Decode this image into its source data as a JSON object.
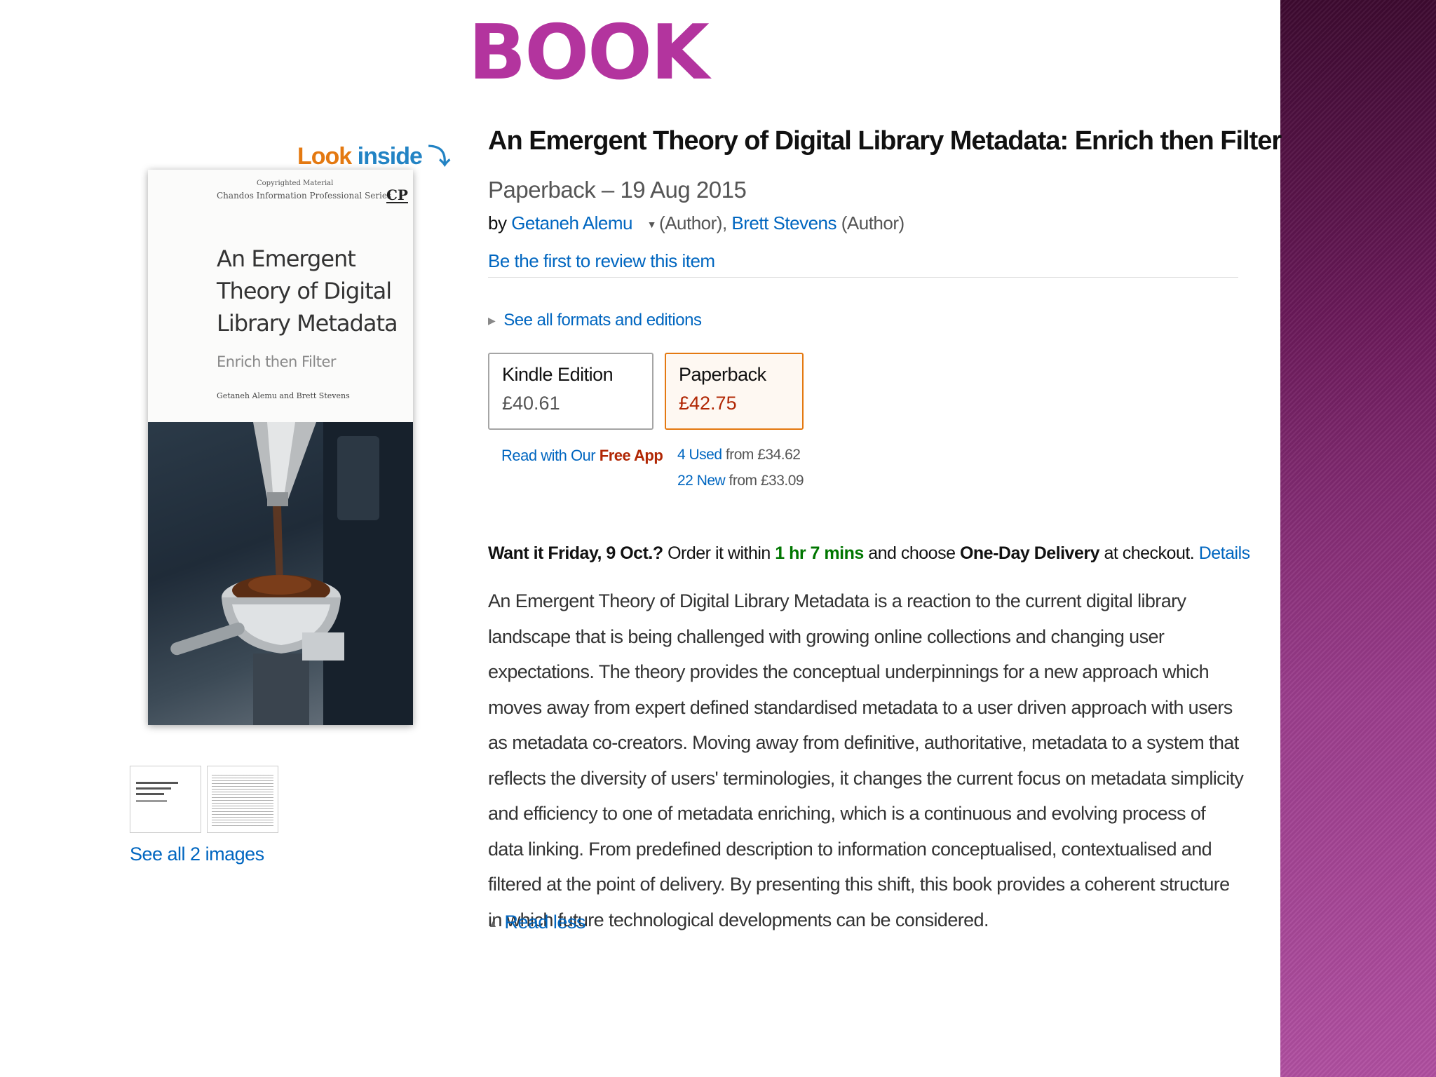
{
  "slide": {
    "title": "BOOK",
    "accent_color": "#b3349e",
    "side_band_color": "#7a2468"
  },
  "gallery": {
    "look_inside_1": "Look",
    "look_inside_2": "inside",
    "look_inside_icon": "down-arrow-icon",
    "cover": {
      "copyright": "Copyrighted Material",
      "series": "Chandos Information Professional Series",
      "publisher_logo": "CP",
      "title": "An Emergent Theory of Digital Library Metadata",
      "subtitle": "Enrich then Filter",
      "authors": "Getaneh Alemu and Brett Stevens"
    },
    "see_all_images": "See all 2 images"
  },
  "product": {
    "title": "An Emergent Theory of Digital Library Metadata: Enrich then Filter",
    "format_date": "Paperback – 19 Aug 2015",
    "by": "by",
    "author1": "Getaneh Alemu",
    "author1_role": "(Author),",
    "author2": "Brett Stevens",
    "author2_role": "(Author)",
    "review_link": "Be the first to review this item",
    "formats_link": "See all formats and editions",
    "swatches": [
      {
        "name": "Kindle Edition",
        "price": "£40.61",
        "selected": false
      },
      {
        "name": "Paperback",
        "price": "£42.75",
        "selected": true
      }
    ],
    "kindle_note": "Read with Our",
    "kindle_free_app": "Free App",
    "used_link": "4 Used",
    "used_from": "from £34.62",
    "new_link": "22 New",
    "new_from": "from £33.09",
    "delivery": {
      "want_it": "Want it Friday, 9 Oct.?",
      "order_within": "Order it within",
      "countdown": "1 hr 7 mins",
      "and_choose": "and choose",
      "one_day": "One-Day Delivery",
      "at_checkout": "at checkout.",
      "details": "Details"
    },
    "description": "An Emergent Theory of Digital Library Metadata is a reaction to the current digital library landscape that is being challenged with growing online collections and changing user expectations. The theory provides the conceptual underpinnings for a new approach which moves away from expert defined standardised metadata to a user driven approach with users as metadata co-creators. Moving away from definitive, authoritative, metadata to a system that reflects the diversity of users' terminologies, it changes the current focus on metadata simplicity and efficiency to one of metadata enriching, which is a continuous and evolving process of data linking. From predefined description to information conceptualised, contextualised and filtered at the point of delivery. By presenting this shift, this book provides a coherent structure in which future technological developments can be considered.",
    "read_less": "Read less",
    "link_color": "#0066c0",
    "price_color": "#b12704",
    "countdown_color": "#007600"
  }
}
